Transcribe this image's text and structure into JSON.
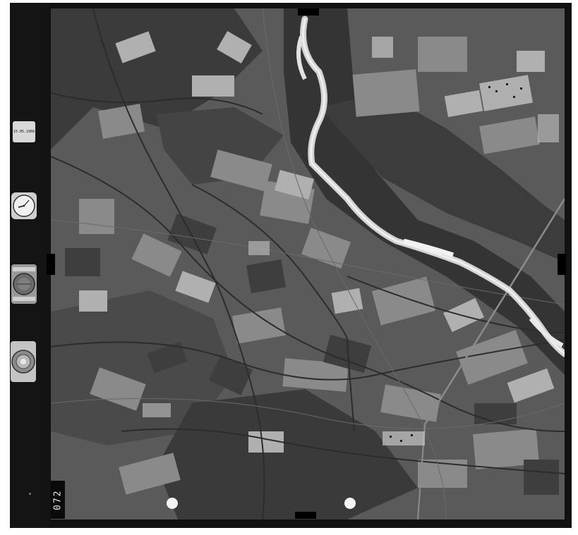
{
  "photo": {
    "frame_number": "072",
    "date_label": "15.05.1966"
  },
  "instruments": {
    "clock_icon": "clock-icon",
    "altimeter_icon": "altimeter-icon",
    "level_icon": "bubble-level-icon"
  },
  "colors": {
    "frame": "#111111",
    "field_light": "#a8a8a8",
    "field_dark": "#3a3a3a",
    "river": "#dcdcdc"
  }
}
